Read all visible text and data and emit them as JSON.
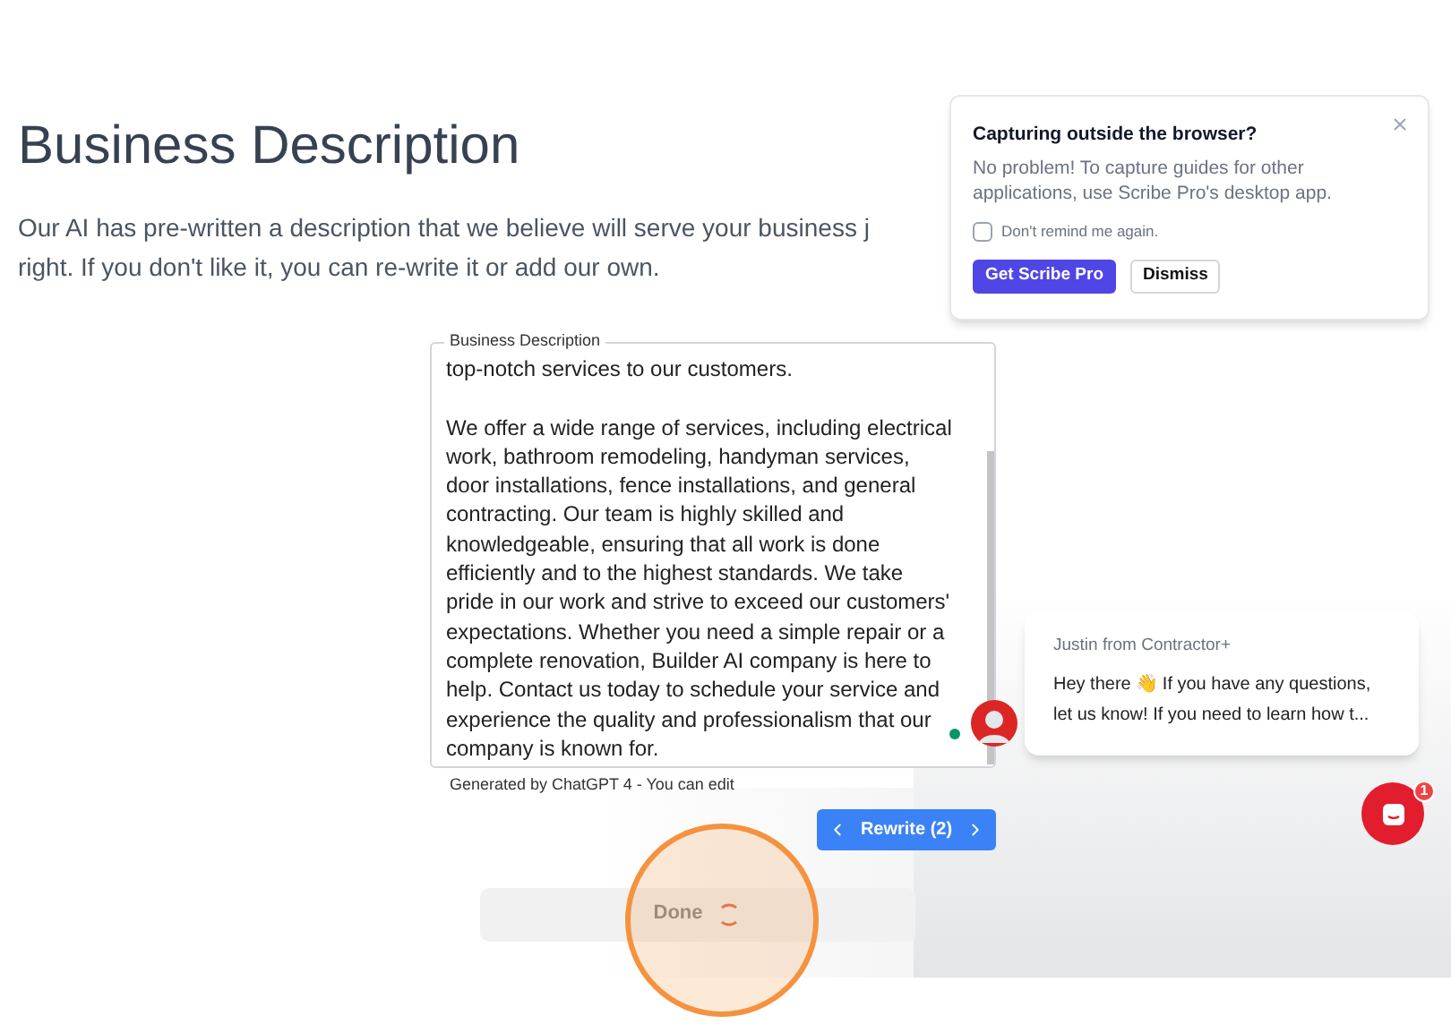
{
  "page": {
    "title": "Business Description",
    "intro_lines": [
      "Our AI has pre-written a description that we believe will serve your business j",
      "right. If you don't like it, you can re-write it or add our own."
    ]
  },
  "description_field": {
    "label": "Business Description",
    "paragraphs": [
      [
        "top-notch services to our customers."
      ],
      [
        "We offer a wide range of services, including electrical",
        "work, bathroom remodeling, handyman services,",
        "door installations, fence installations, and general",
        "contracting. Our team is highly skilled and",
        "knowledgeable, ensuring that all work is done",
        "efficiently and to the highest standards. We take",
        "pride in our work and strive to exceed our customers'",
        "expectations. Whether you need a simple repair or a",
        "complete renovation, Builder AI company is here to",
        "help. Contact us today to schedule your service and",
        "experience the quality and professionalism that our",
        "company is known for."
      ]
    ],
    "online": true,
    "caption": "Generated by ChatGPT 4 - You can edit"
  },
  "rewrite_button": {
    "label": "Rewrite (2)"
  },
  "done_button": {
    "label": "Done",
    "disabled": true,
    "loading": true
  },
  "popup": {
    "title": "Capturing outside the browser?",
    "body": "No problem! To capture guides for other applications, use Scribe Pro's desktop app.",
    "checkbox": {
      "label": "Don't remind me again.",
      "checked": false
    },
    "primary": "Get Scribe Pro",
    "secondary": "Dismiss"
  },
  "chat": {
    "sender": "Justin from Contractor+",
    "message": "Hey there 👋 If you have any questions, let us know! If you need to learn how t...",
    "badge": "1"
  }
}
